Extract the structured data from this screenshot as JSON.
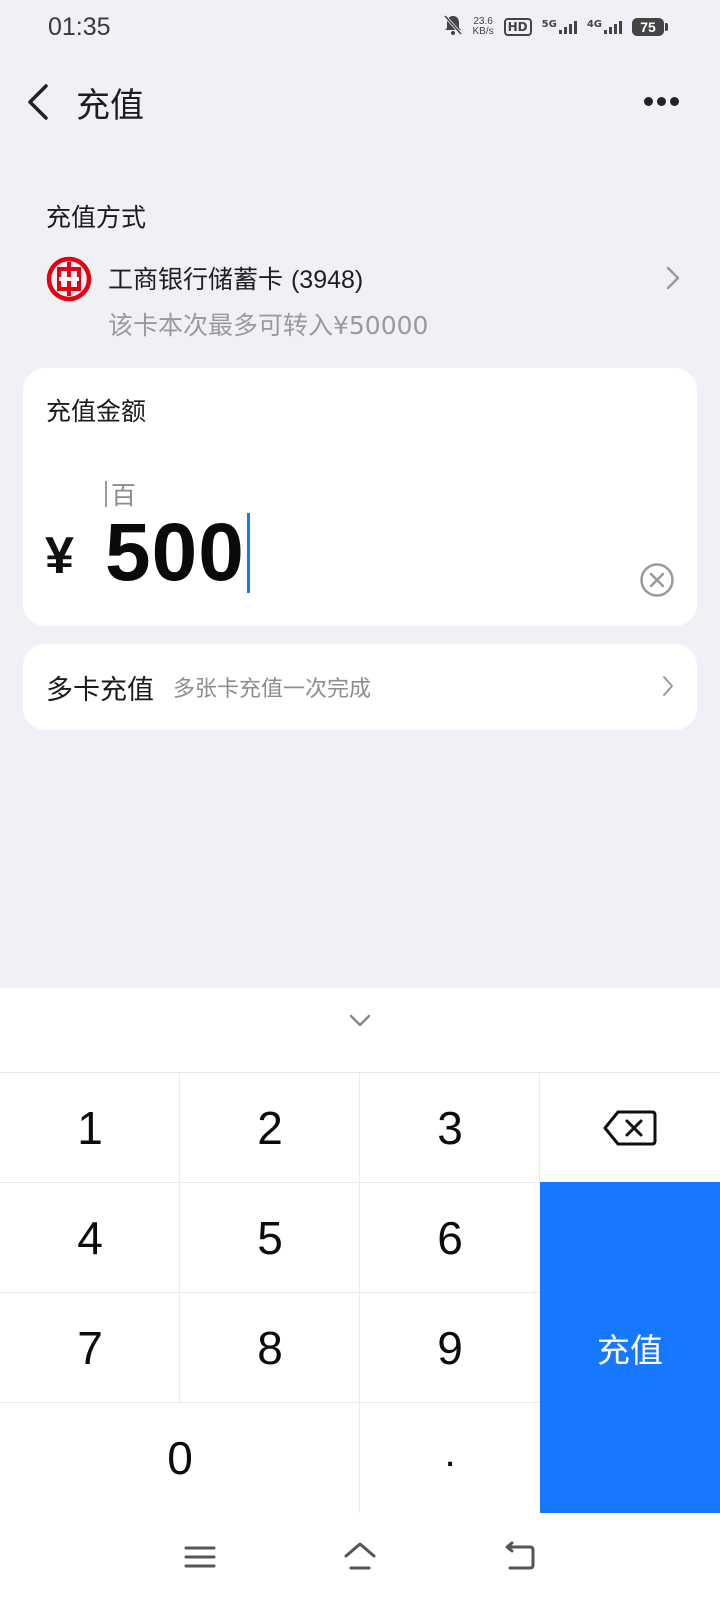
{
  "status_bar": {
    "time": "01:35",
    "net_speed_value": "23.6",
    "net_speed_unit": "KB/s",
    "hd_label": "HD",
    "sim1_label": "5G",
    "sim2_label": "4G",
    "battery": "75"
  },
  "header": {
    "title": "充值"
  },
  "payment_method": {
    "section_label": "充值方式",
    "bank_name": "工商银行储蓄卡",
    "card_suffix": "(3948)",
    "limit_text": "该卡本次最多可转入¥50000"
  },
  "amount": {
    "label": "充值金额",
    "unit_hint": "百",
    "currency": "¥",
    "value": "500"
  },
  "multi_card": {
    "title": "多卡充值",
    "subtitle": "多张卡充值一次完成"
  },
  "keypad": {
    "keys": [
      "1",
      "2",
      "3",
      "4",
      "5",
      "6",
      "7",
      "8",
      "9",
      "0",
      "."
    ],
    "confirm_label": "充值"
  },
  "colors": {
    "accent": "#1677ff",
    "bank_logo": "#e60012",
    "background": "#eff1f6"
  },
  "icons": {
    "back": "chevron-left-icon",
    "more": "more-dots-icon",
    "bank_logo": "icbc-logo-icon",
    "clear": "clear-circle-icon",
    "chevron": "chevron-right-icon",
    "collapse": "chevron-down-icon",
    "backspace": "backspace-icon",
    "menu": "menu-icon",
    "home": "home-icon",
    "nav_back": "nav-back-icon"
  }
}
